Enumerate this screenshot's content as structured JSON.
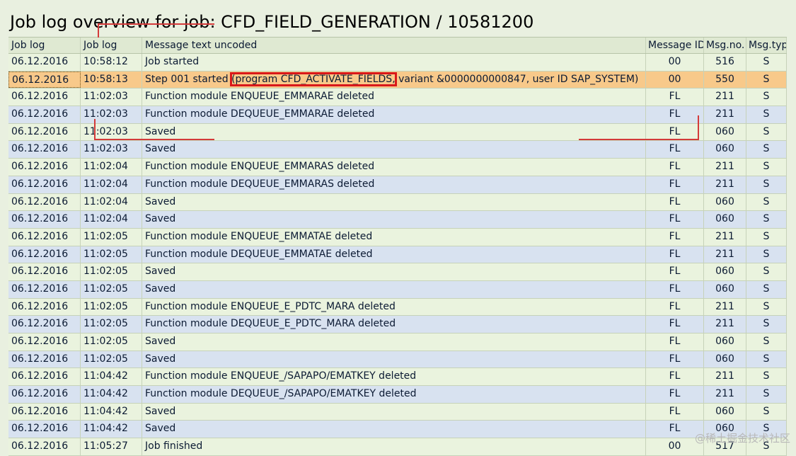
{
  "title": "Job log overview for job: CFD_FIELD_GENERATION / 10581200",
  "columns": [
    "Job log",
    "Job log",
    "Message text uncoded",
    "Message ID",
    "Msg.no.",
    "Msg.typ"
  ],
  "highlight_text": "(program CFD_ACTIVATE_FIELDS,",
  "rows": [
    {
      "date": "06.12.2016",
      "time": "10:58:12",
      "text": "Job started",
      "msgid": "00",
      "msgno": "516",
      "msgtyp": "S"
    },
    {
      "date": "06.12.2016",
      "time": "10:58:13",
      "text_pre": "Step 001 started ",
      "text_post": " variant &0000000000847, user ID SAP_SYSTEM)",
      "msgid": "00",
      "msgno": "550",
      "msgtyp": "S"
    },
    {
      "date": "06.12.2016",
      "time": "11:02:03",
      "text": "Function module ENQUEUE_EMMARAE deleted",
      "msgid": "FL",
      "msgno": "211",
      "msgtyp": "S"
    },
    {
      "date": "06.12.2016",
      "time": "11:02:03",
      "text": "Function module DEQUEUE_EMMARAE deleted",
      "msgid": "FL",
      "msgno": "211",
      "msgtyp": "S"
    },
    {
      "date": "06.12.2016",
      "time": "11:02:03",
      "text": "Saved",
      "msgid": "FL",
      "msgno": "060",
      "msgtyp": "S"
    },
    {
      "date": "06.12.2016",
      "time": "11:02:03",
      "text": "Saved",
      "msgid": "FL",
      "msgno": "060",
      "msgtyp": "S"
    },
    {
      "date": "06.12.2016",
      "time": "11:02:04",
      "text": "Function module ENQUEUE_EMMARAS deleted",
      "msgid": "FL",
      "msgno": "211",
      "msgtyp": "S"
    },
    {
      "date": "06.12.2016",
      "time": "11:02:04",
      "text": "Function module DEQUEUE_EMMARAS deleted",
      "msgid": "FL",
      "msgno": "211",
      "msgtyp": "S"
    },
    {
      "date": "06.12.2016",
      "time": "11:02:04",
      "text": "Saved",
      "msgid": "FL",
      "msgno": "060",
      "msgtyp": "S"
    },
    {
      "date": "06.12.2016",
      "time": "11:02:04",
      "text": "Saved",
      "msgid": "FL",
      "msgno": "060",
      "msgtyp": "S"
    },
    {
      "date": "06.12.2016",
      "time": "11:02:05",
      "text": "Function module ENQUEUE_EMMATAE deleted",
      "msgid": "FL",
      "msgno": "211",
      "msgtyp": "S"
    },
    {
      "date": "06.12.2016",
      "time": "11:02:05",
      "text": "Function module DEQUEUE_EMMATAE deleted",
      "msgid": "FL",
      "msgno": "211",
      "msgtyp": "S"
    },
    {
      "date": "06.12.2016",
      "time": "11:02:05",
      "text": "Saved",
      "msgid": "FL",
      "msgno": "060",
      "msgtyp": "S"
    },
    {
      "date": "06.12.2016",
      "time": "11:02:05",
      "text": "Saved",
      "msgid": "FL",
      "msgno": "060",
      "msgtyp": "S"
    },
    {
      "date": "06.12.2016",
      "time": "11:02:05",
      "text": "Function module ENQUEUE_E_PDTC_MARA deleted",
      "msgid": "FL",
      "msgno": "211",
      "msgtyp": "S"
    },
    {
      "date": "06.12.2016",
      "time": "11:02:05",
      "text": "Function module DEQUEUE_E_PDTC_MARA deleted",
      "msgid": "FL",
      "msgno": "211",
      "msgtyp": "S"
    },
    {
      "date": "06.12.2016",
      "time": "11:02:05",
      "text": "Saved",
      "msgid": "FL",
      "msgno": "060",
      "msgtyp": "S"
    },
    {
      "date": "06.12.2016",
      "time": "11:02:05",
      "text": "Saved",
      "msgid": "FL",
      "msgno": "060",
      "msgtyp": "S"
    },
    {
      "date": "06.12.2016",
      "time": "11:04:42",
      "text": "Function module ENQUEUE_/SAPAPO/EMATKEY deleted",
      "msgid": "FL",
      "msgno": "211",
      "msgtyp": "S"
    },
    {
      "date": "06.12.2016",
      "time": "11:04:42",
      "text": "Function module DEQUEUE_/SAPAPO/EMATKEY deleted",
      "msgid": "FL",
      "msgno": "211",
      "msgtyp": "S"
    },
    {
      "date": "06.12.2016",
      "time": "11:04:42",
      "text": "Saved",
      "msgid": "FL",
      "msgno": "060",
      "msgtyp": "S"
    },
    {
      "date": "06.12.2016",
      "time": "11:04:42",
      "text": "Saved",
      "msgid": "FL",
      "msgno": "060",
      "msgtyp": "S"
    },
    {
      "date": "06.12.2016",
      "time": "11:05:27",
      "text": "Job finished",
      "msgid": "00",
      "msgno": "517",
      "msgtyp": "S"
    }
  ],
  "watermark": "@稀土掘金技术社区",
  "colors": {
    "row_green": "#eaf3de",
    "row_blue": "#d8e2f0",
    "row_selected": "#f8c98a",
    "highlight": "#d9181a"
  }
}
